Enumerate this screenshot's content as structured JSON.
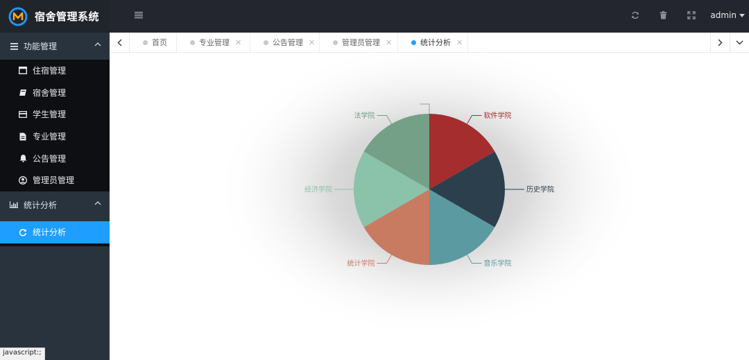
{
  "app": {
    "title": "宿舍管理系统"
  },
  "header": {
    "user": "admin"
  },
  "sidebar": {
    "groups": [
      {
        "label": "功能管理",
        "items": [
          {
            "label": "住宿管理",
            "icon": "window-icon"
          },
          {
            "label": "宿舍管理",
            "icon": "book-icon"
          },
          {
            "label": "学生管理",
            "icon": "card-icon"
          },
          {
            "label": "专业管理",
            "icon": "file-icon"
          },
          {
            "label": "公告管理",
            "icon": "bell-icon"
          },
          {
            "label": "管理员管理",
            "icon": "user-circle-icon"
          }
        ]
      },
      {
        "label": "统计分析",
        "items": [
          {
            "label": "统计分析",
            "icon": "refresh-icon",
            "active": true
          }
        ]
      }
    ]
  },
  "tabs": [
    {
      "label": "首页",
      "closable": false
    },
    {
      "label": "专业管理",
      "closable": true
    },
    {
      "label": "公告管理",
      "closable": true
    },
    {
      "label": "管理员管理",
      "closable": true
    },
    {
      "label": "统计分析",
      "closable": true,
      "active": true
    }
  ],
  "status_bar": {
    "text": "javascript:;"
  },
  "colors": {
    "accent": "#1e9fff",
    "sidebar": "#28333e",
    "header": "#23262e"
  },
  "chart_data": {
    "type": "pie",
    "title": "",
    "categories": [
      "软件学院",
      "历史学院",
      "音乐学院",
      "统计学院",
      "经济学院",
      "法学院",
      ""
    ],
    "values": [
      1,
      1,
      1,
      1,
      1,
      1,
      0
    ],
    "colors": [
      "#a52d2d",
      "#2c3f4c",
      "#5b9aa0",
      "#c87b61",
      "#8bc2aa",
      "#74a087",
      "#999999"
    ]
  }
}
